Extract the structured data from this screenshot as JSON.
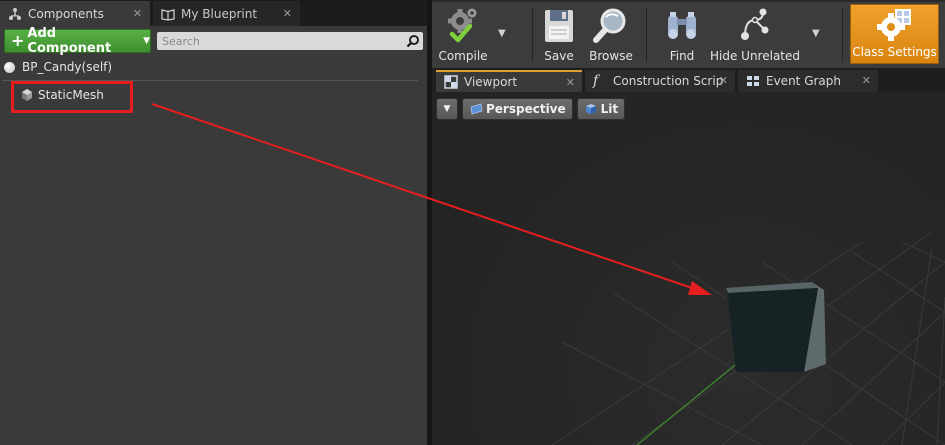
{
  "left_panel": {
    "tabs": [
      {
        "label": "Components",
        "icon": "components-icon"
      },
      {
        "label": "My Blueprint",
        "icon": "book-icon"
      }
    ],
    "add_component_label": "Add Component",
    "search_placeholder": "Search",
    "tree": {
      "root_label": "BP_Candy(self)",
      "child_label": "StaticMesh"
    }
  },
  "toolbar": {
    "compile_label": "Compile",
    "save_label": "Save",
    "browse_label": "Browse",
    "find_label": "Find",
    "hide_unrelated_label": "Hide Unrelated",
    "class_settings_label": "Class Settings"
  },
  "doc_tabs": [
    {
      "label": "Viewport",
      "icon": "viewport-icon"
    },
    {
      "label": "Construction Scrip",
      "icon": "function-icon"
    },
    {
      "label": "Event Graph",
      "icon": "graph-icon"
    }
  ],
  "viewport": {
    "perspective_label": "Perspective",
    "lit_label": "Lit"
  },
  "colors": {
    "accent_orange": "#e59a22",
    "add_green": "#4ea63c",
    "annotation_red": "#e51f1f"
  }
}
